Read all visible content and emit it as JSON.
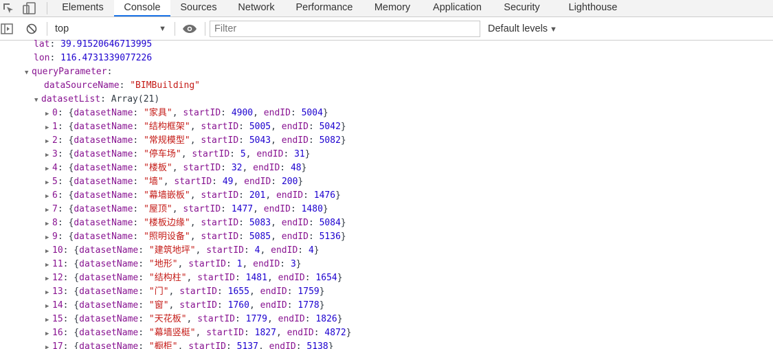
{
  "tabs": [
    "Elements",
    "Console",
    "Sources",
    "Network",
    "Performance",
    "Memory",
    "Application",
    "Security",
    "Lighthouse"
  ],
  "active_tab": "Console",
  "toolbar": {
    "context": "top",
    "filter_placeholder": "Filter",
    "levels": "Default levels"
  },
  "icons": {
    "inspect": "inspect-element-icon",
    "device": "device-toolbar-icon",
    "sidebar": "show-sidebar-icon",
    "clear": "clear-console-icon",
    "eye": "live-expression-eye-icon",
    "expanded": "expanded-triangle-icon",
    "collapsed": "collapsed-triangle-icon"
  },
  "colors": {
    "key": "#881391",
    "number": "#1c00cf",
    "string": "#c41a16",
    "text": "#303942",
    "active_tab_underline": "#1a73e8"
  },
  "console": {
    "lat": {
      "key": "lat",
      "value": "39.91520646713995"
    },
    "lon": {
      "key": "lon",
      "value": "116.4731339077226"
    },
    "queryParameter": {
      "key": "queryParameter"
    },
    "dataSourceName": {
      "key": "dataSourceName",
      "value": "\"BIMBuilding\""
    },
    "datasetList": {
      "key": "datasetList",
      "summary": "Array(21)"
    },
    "items": [
      {
        "index": "0",
        "name": "\"家具\"",
        "startID": "4900",
        "endID": "5004"
      },
      {
        "index": "1",
        "name": "\"结构框架\"",
        "startID": "5005",
        "endID": "5042"
      },
      {
        "index": "2",
        "name": "\"常规模型\"",
        "startID": "5043",
        "endID": "5082"
      },
      {
        "index": "3",
        "name": "\"停车场\"",
        "startID": "5",
        "endID": "31"
      },
      {
        "index": "4",
        "name": "\"楼板\"",
        "startID": "32",
        "endID": "48"
      },
      {
        "index": "5",
        "name": "\"墙\"",
        "startID": "49",
        "endID": "200"
      },
      {
        "index": "6",
        "name": "\"幕墙嵌板\"",
        "startID": "201",
        "endID": "1476"
      },
      {
        "index": "7",
        "name": "\"屋顶\"",
        "startID": "1477",
        "endID": "1480"
      },
      {
        "index": "8",
        "name": "\"楼板边缘\"",
        "startID": "5083",
        "endID": "5084"
      },
      {
        "index": "9",
        "name": "\"照明设备\"",
        "startID": "5085",
        "endID": "5136"
      },
      {
        "index": "10",
        "name": "\"建筑地坪\"",
        "startID": "4",
        "endID": "4"
      },
      {
        "index": "11",
        "name": "\"地形\"",
        "startID": "1",
        "endID": "3"
      },
      {
        "index": "12",
        "name": "\"结构柱\"",
        "startID": "1481",
        "endID": "1654"
      },
      {
        "index": "13",
        "name": "\"门\"",
        "startID": "1655",
        "endID": "1759"
      },
      {
        "index": "14",
        "name": "\"窗\"",
        "startID": "1760",
        "endID": "1778"
      },
      {
        "index": "15",
        "name": "\"天花板\"",
        "startID": "1779",
        "endID": "1826"
      },
      {
        "index": "16",
        "name": "\"幕墙竖梃\"",
        "startID": "1827",
        "endID": "4872"
      },
      {
        "index": "17",
        "name": "\"橱柜\"",
        "startID": "5137",
        "endID": "5138"
      }
    ]
  }
}
